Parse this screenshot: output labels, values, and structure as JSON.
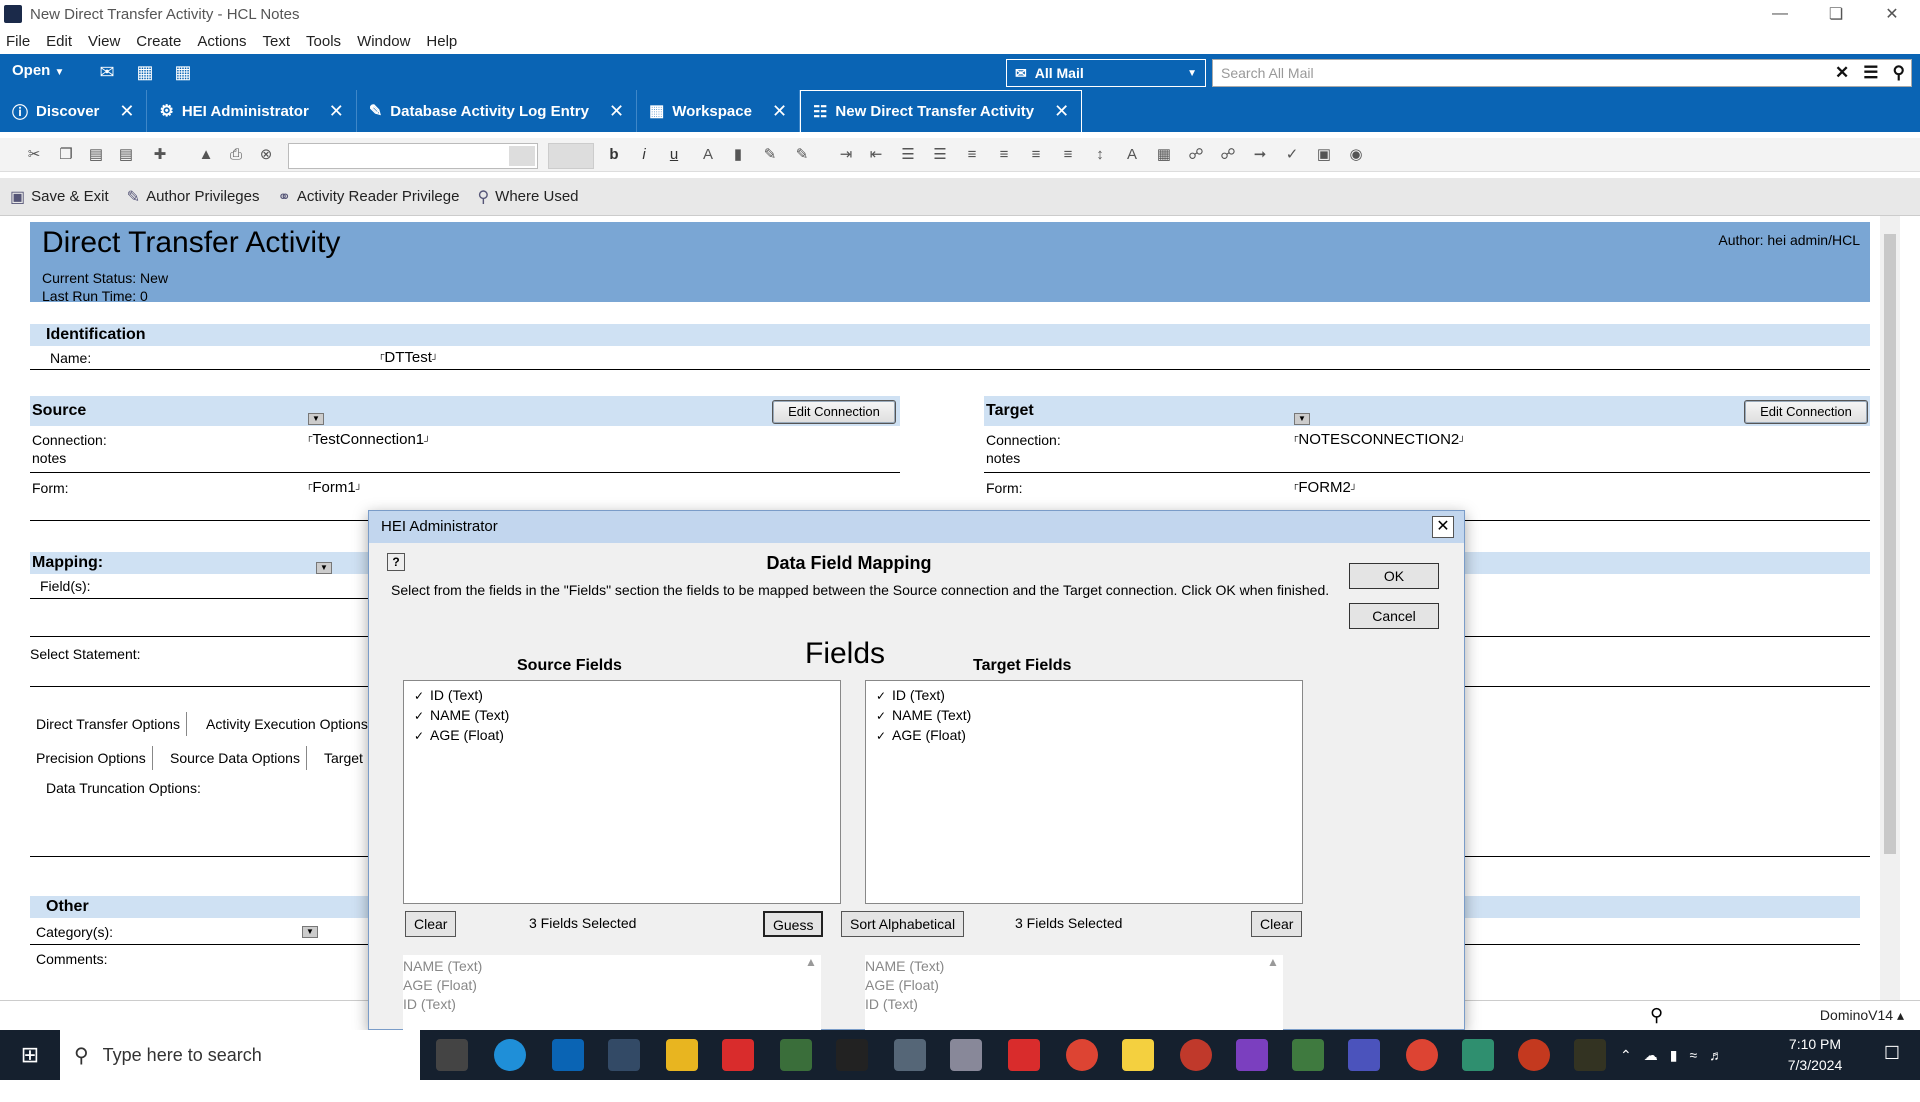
{
  "window": {
    "title": "New  Direct Transfer Activity - HCL Notes",
    "controls": [
      "minimize-icon",
      "restore-icon",
      "close-icon"
    ]
  },
  "menu": [
    "File",
    "Edit",
    "View",
    "Create",
    "Actions",
    "Text",
    "Tools",
    "Window",
    "Help"
  ],
  "topbar": {
    "open_label": "Open",
    "mail_scope": "All Mail",
    "search_placeholder": "Search All Mail"
  },
  "tabs": [
    {
      "label": "Discover",
      "icon": "info-icon"
    },
    {
      "label": "HEI Administrator",
      "icon": "admin-icon"
    },
    {
      "label": "Database Activity Log Entry",
      "icon": "log-icon"
    },
    {
      "label": "Workspace",
      "icon": "grid-icon"
    },
    {
      "label": "New  Direct Transfer Activity",
      "icon": "document-icon",
      "active": true
    }
  ],
  "actions": [
    "Save & Exit",
    "Author Privileges",
    "Activity Reader Privilege",
    "Where Used"
  ],
  "document": {
    "title": "Direct Transfer Activity",
    "status": "Current Status: New",
    "last_run": "Last Run Time:  0",
    "author": "Author: hei admin/HCL",
    "identification": {
      "heading": "Identification",
      "name_label": "Name:",
      "name_value": "DTTest"
    },
    "source": {
      "heading": "Source",
      "edit_label": "Edit Connection",
      "connection_label": "Connection:",
      "connection_sub": "notes",
      "connection_value": "TestConnection1",
      "form_label": "Form:",
      "form_value": "Form1"
    },
    "target": {
      "heading": "Target",
      "edit_label": "Edit Connection",
      "connection_label": "Connection:",
      "connection_sub": "notes",
      "connection_value": "NOTESCONNECTION2",
      "form_label": "Form:",
      "form_value": "FORM2"
    },
    "mapping": {
      "heading": "Mapping:",
      "fields_label": "Field(s):",
      "select_label": "Select Statement:"
    },
    "option_tabs_row1": [
      "Direct Transfer Options",
      "Activity Execution Options"
    ],
    "option_tabs_row2": [
      "Precision Options",
      "Source Data Options",
      "Target"
    ],
    "truncation_label": "Data Truncation Options:",
    "other": {
      "heading": "Other",
      "category_label": "Category(s):",
      "comments_label": "Comments:"
    }
  },
  "status_bar": {
    "server": "DominoV14 ▴"
  },
  "dialog": {
    "title": "HEI Administrator",
    "heading": "Data Field Mapping",
    "instructions": "Select from the fields in the \"Fields\" section the fields to be mapped between the Source connection and the Target connection. Click OK when finished.",
    "ok_label": "OK",
    "cancel_label": "Cancel",
    "fields_title": "Fields",
    "source_header": "Source Fields",
    "target_header": "Target Fields",
    "source_fields": [
      "ID (Text)",
      "NAME (Text)",
      "AGE (Float)"
    ],
    "target_fields": [
      "ID (Text)",
      "NAME (Text)",
      "AGE (Float)"
    ],
    "clear_label": "Clear",
    "guess_label": "Guess",
    "sort_label": "Sort Alphabetical",
    "source_count": "3 Fields Selected",
    "target_count": "3 Fields Selected",
    "source_order": [
      "NAME (Text)",
      "AGE (Float)",
      "ID (Text)"
    ],
    "target_order": [
      "NAME (Text)",
      "AGE (Float)",
      "ID (Text)"
    ]
  },
  "taskbar": {
    "search_placeholder": "Type here to search",
    "time": "7:10 PM",
    "date": "7/3/2024"
  },
  "colors": {
    "notes_blue": "#0a64b4",
    "header_blue": "#7aa6d4",
    "section_blue": "#cfe1f3",
    "taskbar": "#15202e"
  }
}
